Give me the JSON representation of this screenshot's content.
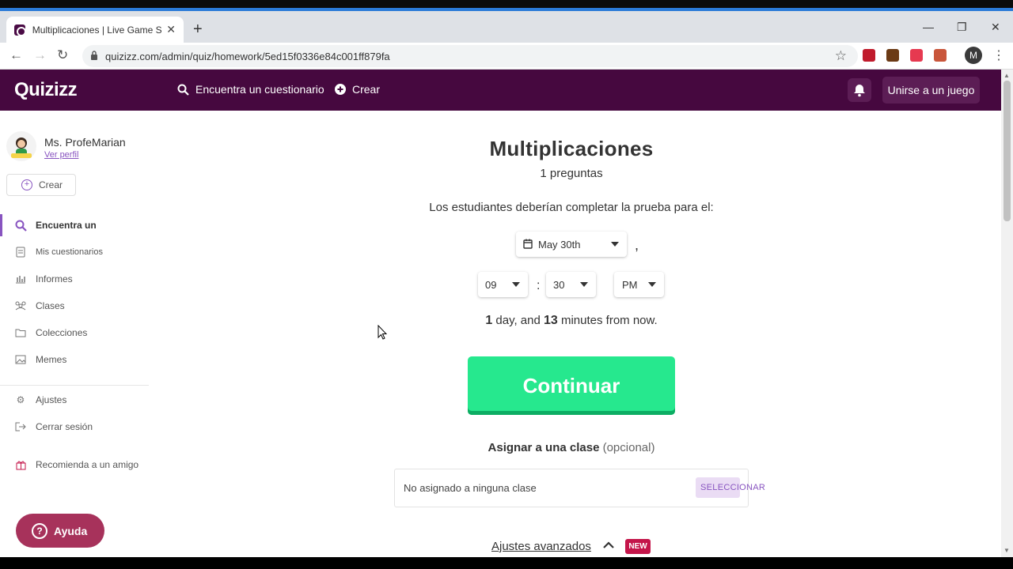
{
  "browser": {
    "tab_title": "Multiplicaciones | Live Game Setti",
    "url": "quizizz.com/admin/quiz/homework/5ed15f0336e84c001ff879fa",
    "profile_initial": "M"
  },
  "header": {
    "logo": "Quizizz",
    "find_quiz": "Encuentra un cuestionario",
    "create": "Crear",
    "join_game": "Unirse a un juego"
  },
  "sidebar": {
    "user_name": "Ms. ProfeMarian",
    "view_profile": "Ver perfil",
    "create": "Crear",
    "items": [
      {
        "label": "Encuentra un",
        "icon": "search-icon"
      },
      {
        "label": "Mis cuestionarios",
        "icon": "document-icon"
      },
      {
        "label": "Informes",
        "icon": "chart-icon"
      },
      {
        "label": "Clases",
        "icon": "users-icon"
      },
      {
        "label": "Colecciones",
        "icon": "folder-icon"
      },
      {
        "label": "Memes",
        "icon": "image-icon"
      },
      {
        "label": "Ajustes",
        "icon": "gear-icon"
      },
      {
        "label": "Cerrar sesión",
        "icon": "logout-icon"
      },
      {
        "label": "Recomienda a un amigo",
        "icon": "gift-icon"
      }
    ],
    "help": "Ayuda"
  },
  "main": {
    "title": "Multiplicaciones",
    "question_count": "1 preguntas",
    "prompt": "Los estudiantes deberían completar la prueba para el:",
    "date": "May 30th",
    "hour": "09",
    "minute": "30",
    "ampm": "PM",
    "relative_days": "1",
    "relative_mid": " day, and ",
    "relative_minutes": "13",
    "relative_end": " minutes from now.",
    "continue": "Continuar",
    "assign_title": "Asignar a una clase",
    "assign_optional": "(opcional)",
    "assign_placeholder": "No asignado a ninguna clase",
    "select": "SELECCIONAR",
    "advanced": "Ajustes avanzados",
    "new_badge": "NEW"
  },
  "colors": {
    "brand_header": "#46083f",
    "accent_purple": "#8854c0",
    "continue_green": "#26e88e",
    "help_button": "#a7325b",
    "new_badge": "#c4154a"
  }
}
